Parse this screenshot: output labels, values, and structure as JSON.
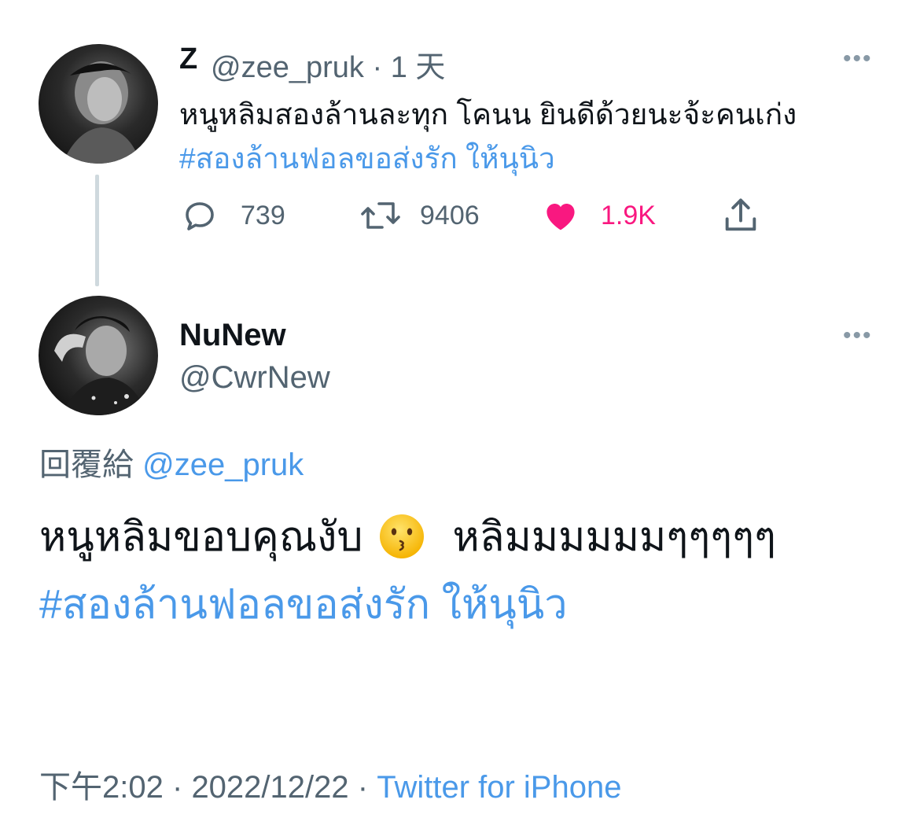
{
  "parent_tweet": {
    "display_name": "Z",
    "handle": "@zee_pruk",
    "separator": "·",
    "time_ago": "1 天",
    "text": "หนูหลิมสองล้านละทุก โคนน ยินดีด้วยนะจ้ะคนเก่ง",
    "hashtag": "#สองล้านฟอลขอส่งรัก ให้นุนิว",
    "more_label": "•••",
    "actions": {
      "replies": "739",
      "retweets": "9406",
      "likes": "1.9K",
      "reply_icon": "reply-icon",
      "retweet_icon": "retweet-icon",
      "like_icon": "heart-icon",
      "share_icon": "share-icon"
    }
  },
  "reply_tweet": {
    "display_name": "NuNew",
    "handle": "@CwrNew",
    "more_label": "•••",
    "reply_to_prefix": "回覆給",
    "reply_to_mention": "@zee_pruk",
    "text_before_emoji": "หนูหลิมขอบคุณงับ",
    "emoji": "kissing-face-emoji",
    "text_after_emoji": "หลิมมมมมมๆๆๆๆๆ",
    "hashtag": "#สองล้านฟอลขอส่งรัก ให้นุนิว"
  },
  "meta": {
    "time": "下午2:02",
    "date": "2022/12/22",
    "separator": "·",
    "source": "Twitter for iPhone"
  },
  "colors": {
    "link": "#4a99e9",
    "secondary_text": "#536471",
    "like": "#f91880",
    "thread_line": "#cfd9de"
  }
}
